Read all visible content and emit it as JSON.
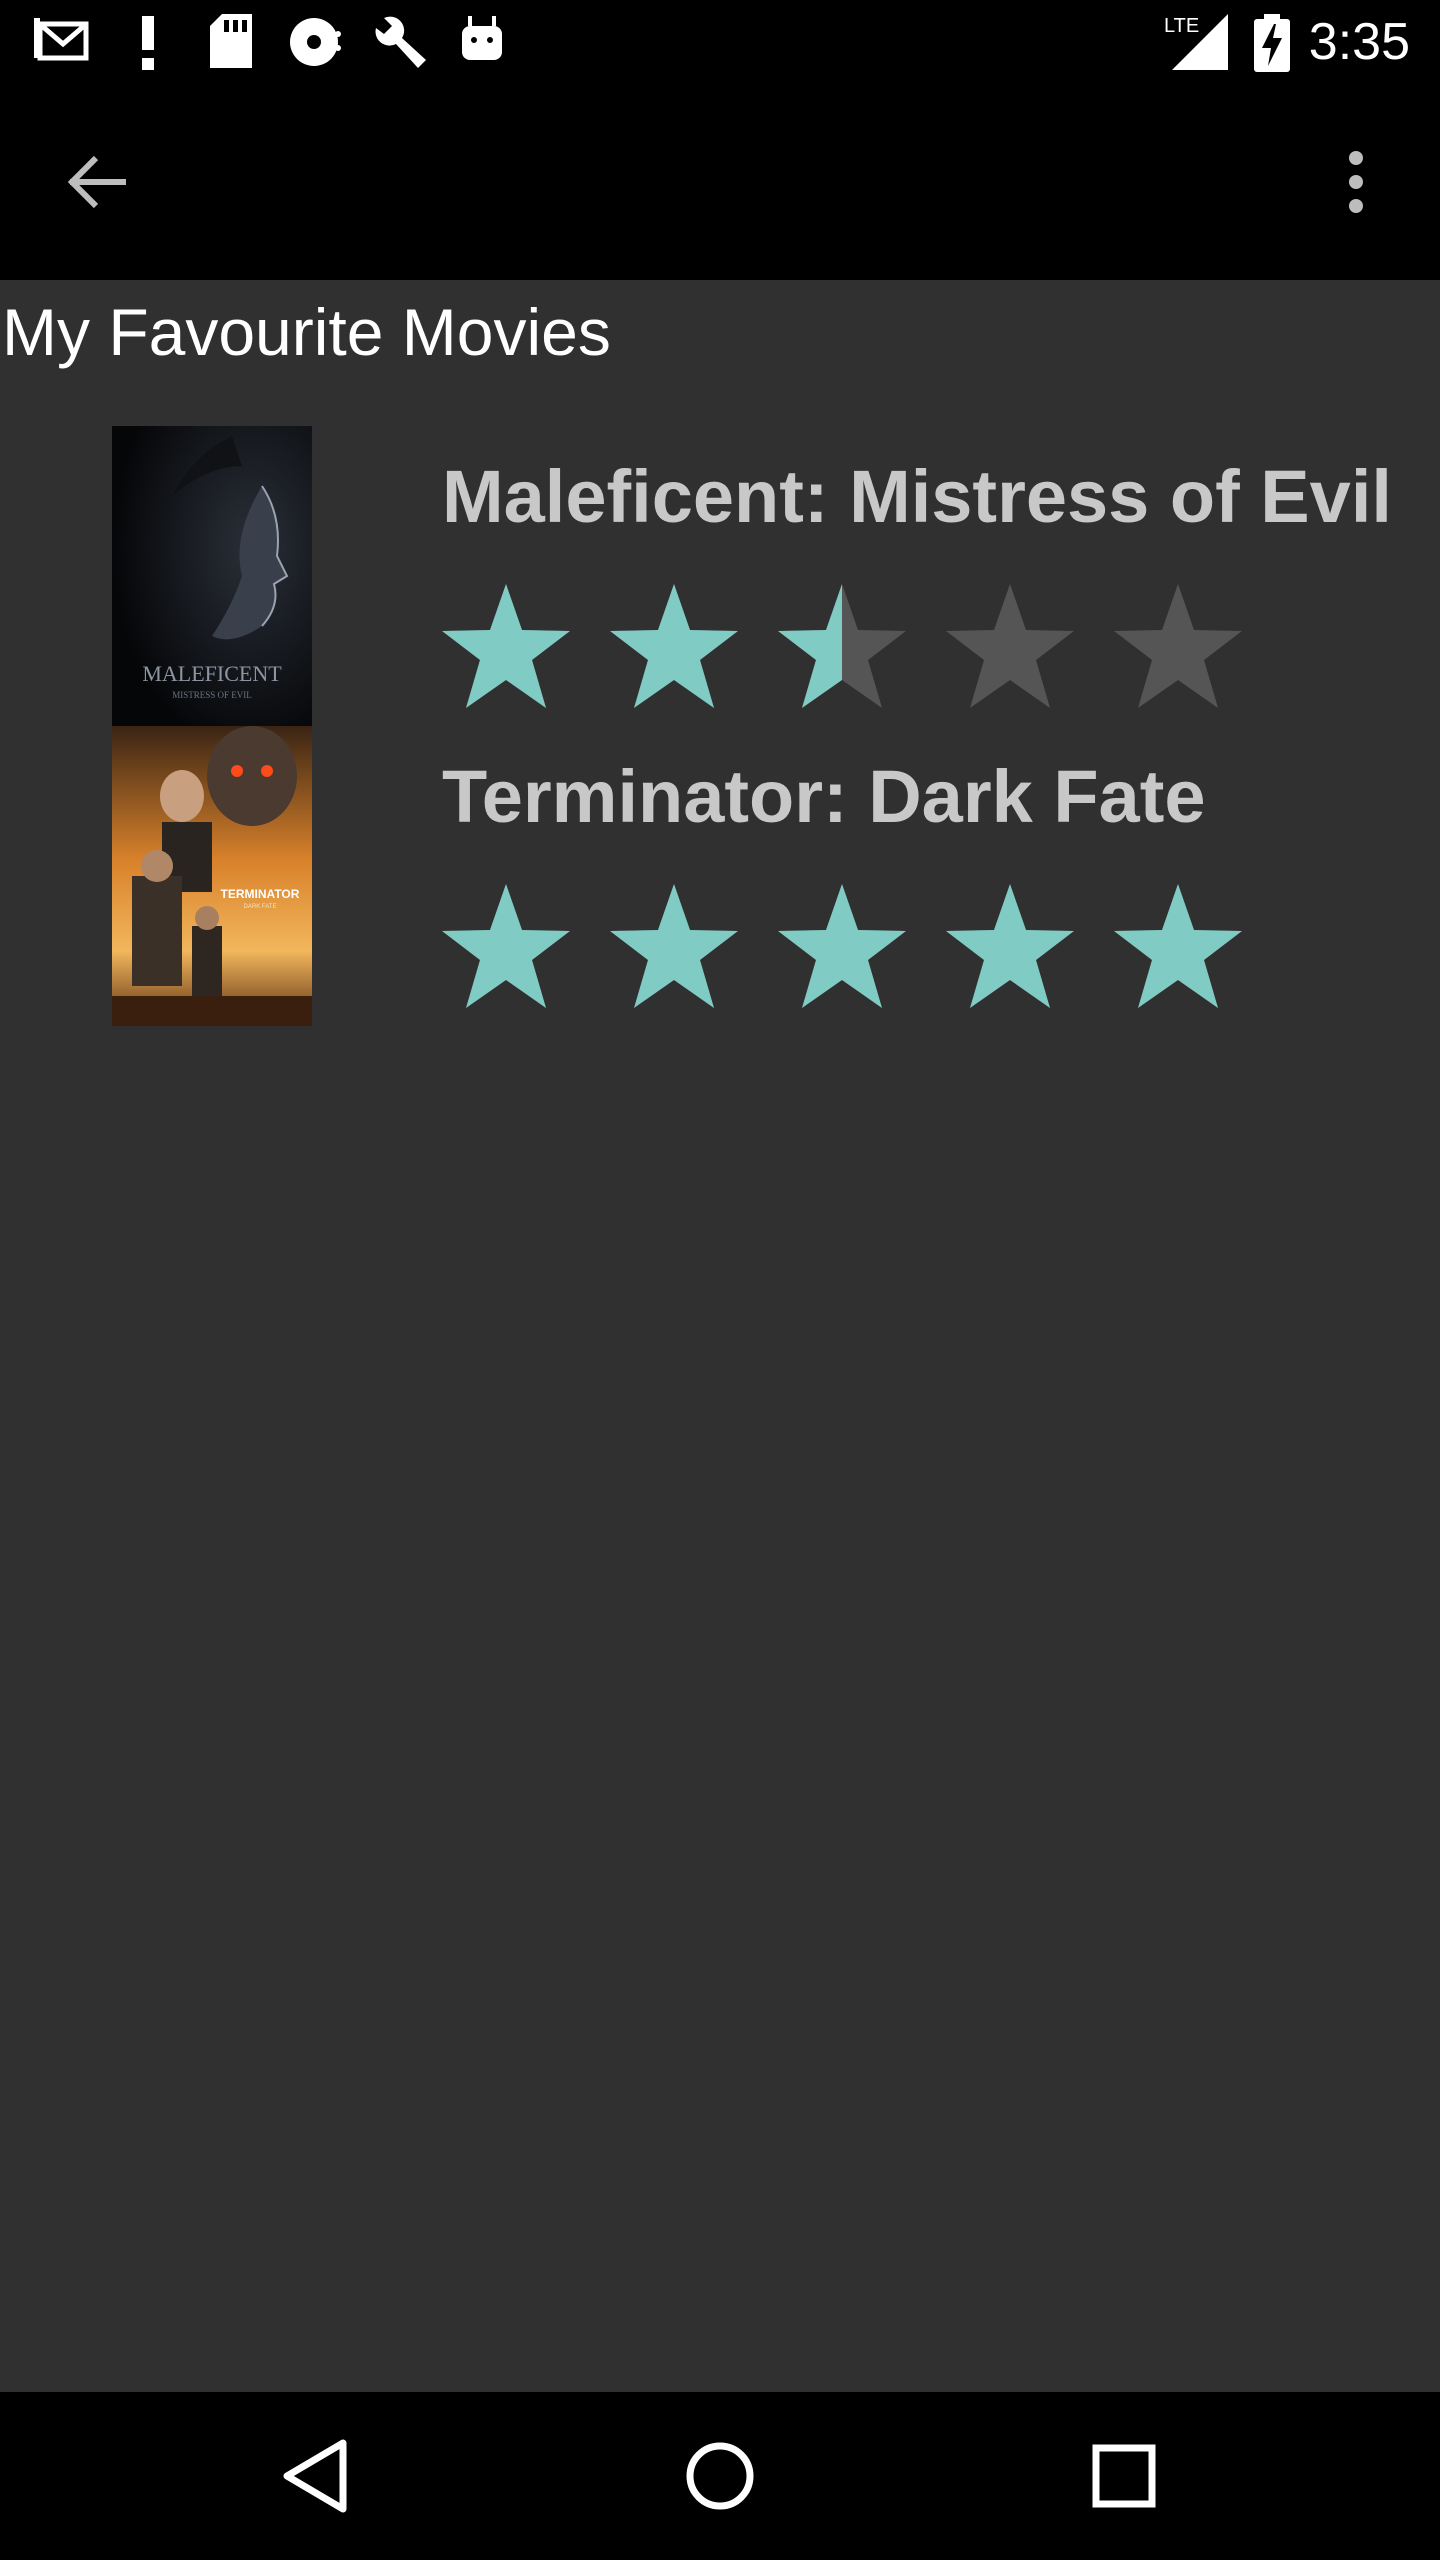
{
  "status_bar": {
    "time": "3:35",
    "network": "LTE",
    "icons": [
      "gmail-icon",
      "alert-icon",
      "sd-card-icon",
      "disc-icon",
      "wrench-icon",
      "android-icon"
    ]
  },
  "app_bar": {
    "back_icon": "arrow-back-icon",
    "overflow_icon": "more-vert-icon"
  },
  "page": {
    "title": "My Favourite Movies"
  },
  "movies": [
    {
      "title": "Maleficent: Mistress of Evil",
      "poster_text": "MALEFICENT",
      "poster_subtext": "MISTRESS OF EVIL",
      "rating": 2.5,
      "max_rating": 5
    },
    {
      "title": "Terminator: Dark Fate",
      "poster_text": "TERMINATOR",
      "poster_subtext": "DARK FATE",
      "rating": 5,
      "max_rating": 5
    }
  ],
  "colors": {
    "star_filled": "#80cbc4",
    "star_empty": "#555555",
    "background": "#303030",
    "bars": "#000000"
  },
  "nav_bar": {
    "icons": [
      "nav-back-icon",
      "home-icon",
      "recents-icon"
    ]
  }
}
